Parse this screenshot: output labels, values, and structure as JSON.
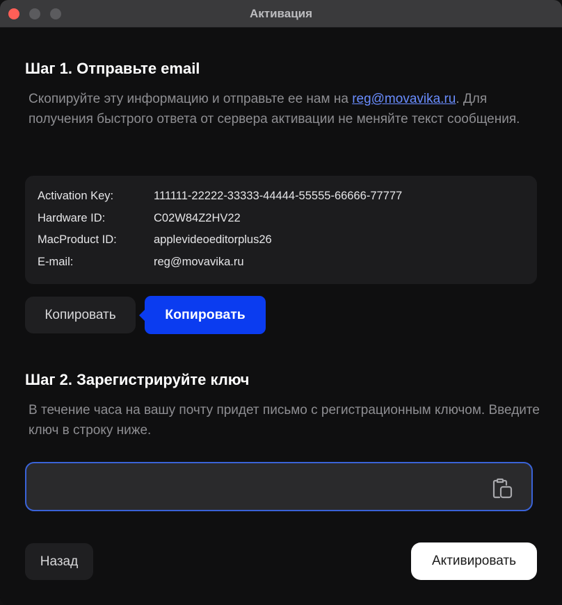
{
  "window": {
    "title": "Активация"
  },
  "step1": {
    "title": "Шаг 1. Отправьте email",
    "desc_before": "Скопируйте эту информацию и отправьте ее нам на ",
    "desc_link": "reg@movavika.ru",
    "desc_after": ". Для получения быстрого ответа от сервера активации не меняйте текст сообщения."
  },
  "info": {
    "rows": [
      {
        "label": "Activation Key:",
        "value": "111111-22222-33333-44444-55555-66666-77777"
      },
      {
        "label": "Hardware ID:",
        "value": "C02W84Z2HV22"
      },
      {
        "label": "MacProduct ID:",
        "value": "applevideoeditorplus26"
      },
      {
        "label": "E-mail:",
        "value": "reg@movavika.ru"
      }
    ]
  },
  "copy_button": {
    "label": "Копировать"
  },
  "tooltip": {
    "label": "Копировать"
  },
  "step2": {
    "title": "Шаг 2. Зарегистрируйте ключ",
    "desc": "В течение часа на вашу почту придет письмо с регистрационным ключом. Введите ключ в строку ниже."
  },
  "key_input": {
    "value": "",
    "placeholder": "",
    "icon": "paste-icon"
  },
  "footer": {
    "back_label": "Назад",
    "activate_label": "Активировать"
  },
  "colors": {
    "accent": "#0b3cf0",
    "link": "#6a8dff",
    "input_border": "#3a63d8",
    "close": "#fe5f57"
  }
}
